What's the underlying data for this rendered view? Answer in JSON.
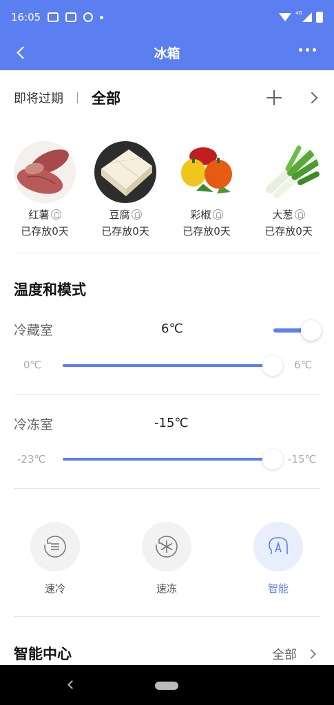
{
  "status_bar": {
    "time": "16:05",
    "network": "4G"
  },
  "header": {
    "title": "冰箱"
  },
  "food": {
    "tab_expiring": "即将过期",
    "tab_all": "全部",
    "items": [
      {
        "name": "红薯",
        "days": "已存放0天"
      },
      {
        "name": "豆腐",
        "days": "已存放0天"
      },
      {
        "name": "彩椒",
        "days": "已存放0天"
      },
      {
        "name": "大葱",
        "days": "已存放0天"
      }
    ]
  },
  "temperature": {
    "section_title": "温度和模式",
    "fridge": {
      "label": "冷藏室",
      "value": "6℃",
      "min": "0℃",
      "max": "6℃",
      "level": 1.0,
      "enabled": true
    },
    "freezer": {
      "label": "冷冻室",
      "value": "-15℃",
      "min": "-23℃",
      "max": "-15℃",
      "level": 1.0
    }
  },
  "modes": [
    {
      "label": "速冷",
      "icon": "quick-cool-icon",
      "active": false
    },
    {
      "label": "速冻",
      "icon": "quick-freeze-icon",
      "active": false
    },
    {
      "label": "智能",
      "icon": "smart-mode-icon",
      "active": true
    }
  ],
  "smart_center": {
    "title": "智能中心",
    "more": "全部"
  },
  "colors": {
    "accent": "#5b7ef0",
    "accent_light": "#e9eefd"
  }
}
